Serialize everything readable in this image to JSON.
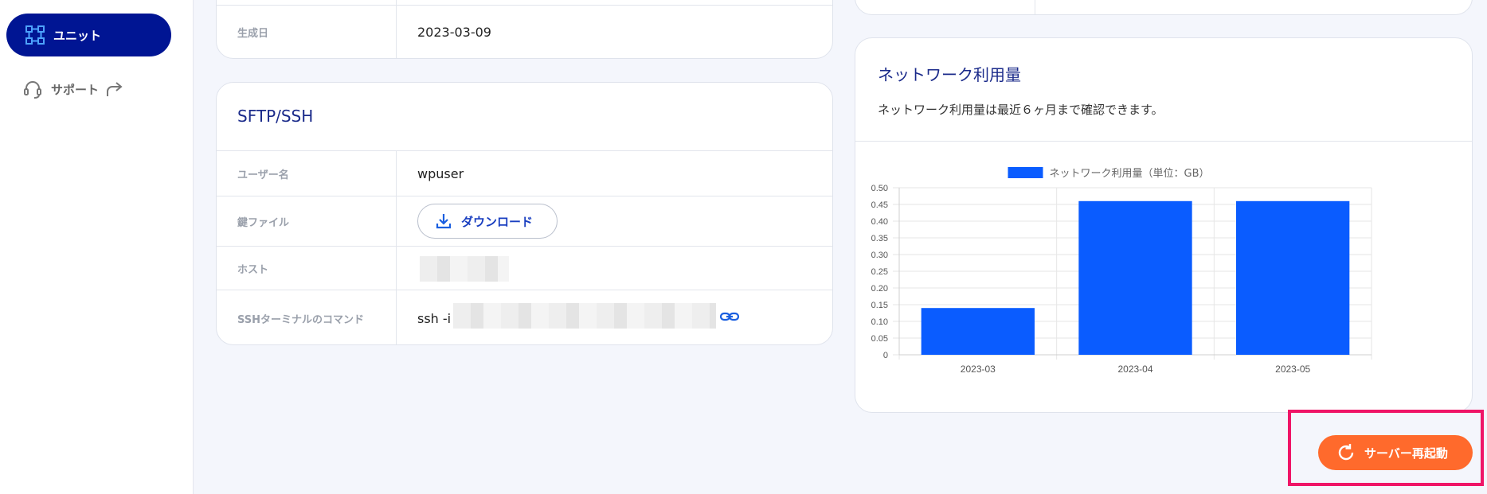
{
  "sidebar": {
    "items": [
      {
        "label": "ユニット",
        "icon": "unit-grid-icon",
        "active": true
      },
      {
        "label": "サポート",
        "icon": "headset-icon",
        "external_icon": "share-arrow-icon"
      }
    ]
  },
  "info_card": {
    "rows": [
      {
        "label": "生成日",
        "value": "2023-03-09"
      }
    ]
  },
  "sftp": {
    "title": "SFTP/SSH",
    "rows": [
      {
        "label": "ユーザー名",
        "value": "wpuser"
      },
      {
        "label": "鍵ファイル",
        "button": "ダウンロード"
      },
      {
        "label": "ホスト",
        "value": ""
      },
      {
        "label": "SSHターミナルのコマンド",
        "value": "ssh -i"
      }
    ]
  },
  "network": {
    "title": "ネットワーク利用量",
    "description": "ネットワーク利用量は最近６ヶ月まで確認できます。"
  },
  "chart_data": {
    "type": "bar",
    "categories": [
      "2023-03",
      "2023-04",
      "2023-05"
    ],
    "series": [
      {
        "name": "ネットワーク利用量（単位：GB）",
        "values": [
          0.14,
          0.46,
          0.46
        ],
        "color": "#0a5cff"
      }
    ],
    "ylim": [
      0,
      0.5
    ],
    "yticks": [
      "0.50",
      "0.45",
      "0.40",
      "0.35",
      "0.30",
      "0.25",
      "0.20",
      "0.15",
      "0.10",
      "0.05",
      "0"
    ],
    "legend_position": "top-center",
    "grid": true
  },
  "actions": {
    "restart_label": "サーバー再起動"
  },
  "colors": {
    "primary": "#001593",
    "accent": "#ff6a2c",
    "bar": "#0a5cff",
    "highlight": "#ef1567"
  }
}
